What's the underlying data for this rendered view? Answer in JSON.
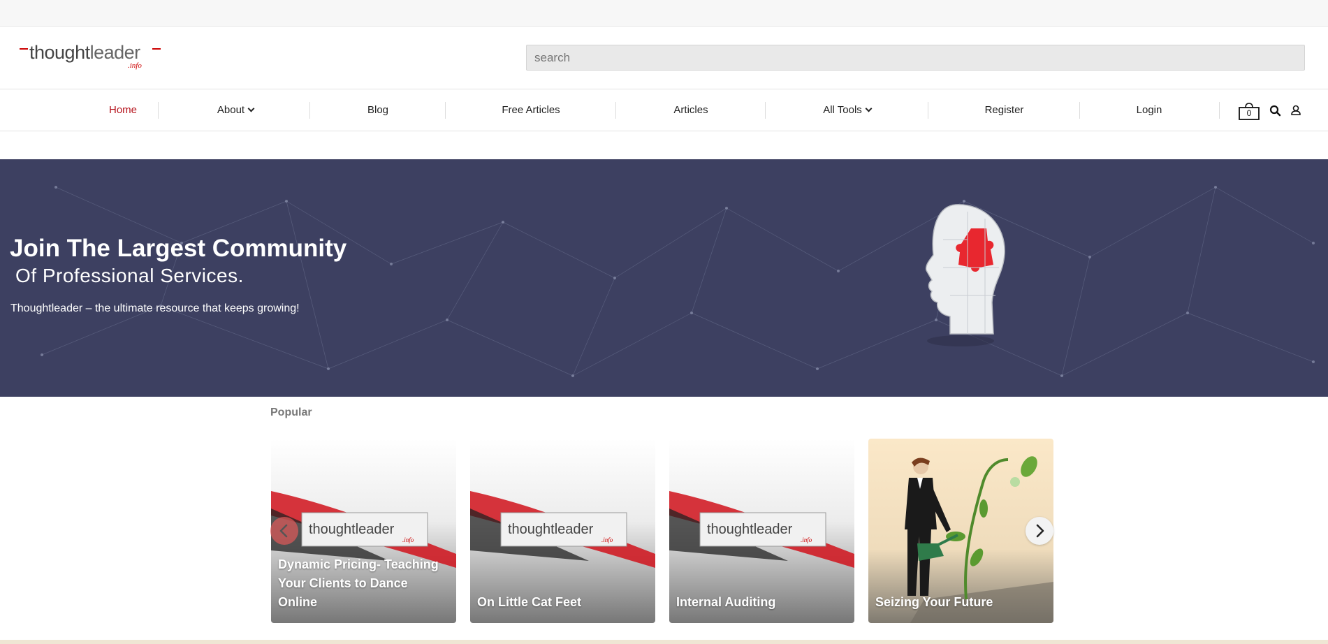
{
  "brand": {
    "logo_main": "thought",
    "logo_light": "leader",
    "logo_sub": ".info"
  },
  "search": {
    "placeholder": "search"
  },
  "nav": {
    "items": [
      "Home",
      "About",
      "Blog",
      "Free Articles",
      "Articles",
      "All Tools",
      "Register",
      "Login"
    ],
    "active": "Home",
    "cart_count": "0"
  },
  "hero": {
    "title": "Join The Largest Community",
    "subtitle": "Of Professional Services.",
    "text": "Thoughtleader – the ultimate resource that keeps growing!"
  },
  "popular": {
    "heading": "Popular",
    "cards": [
      {
        "title": "Dynamic Pricing- Teaching Your Clients to Dance Online",
        "image": "thoughtleader-logo-banner"
      },
      {
        "title": "On Little Cat Feet",
        "image": "thoughtleader-logo-banner"
      },
      {
        "title": "Internal Auditing",
        "image": "thoughtleader-logo-banner"
      },
      {
        "title": "Seizing Your Future",
        "image": "businessman-watering-plant"
      }
    ]
  },
  "colors": {
    "accent": "#b5121b",
    "hero_bg": "#3d4061",
    "puzzle": "#e8272f"
  }
}
